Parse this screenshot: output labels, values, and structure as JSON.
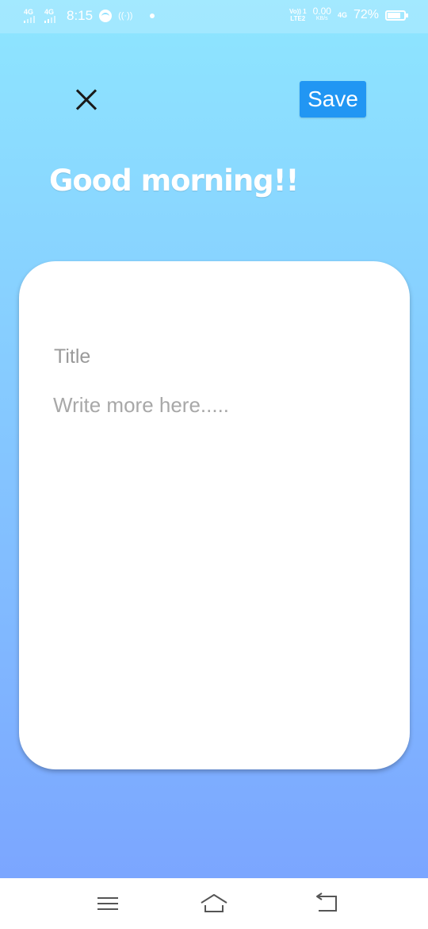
{
  "status_bar": {
    "net_left_1": "4G",
    "net_left_2": "4G",
    "time": "8:15",
    "volte_1": "Vo)) 1",
    "volte_2": "LTE2",
    "speed_value": "0.00",
    "speed_unit": "KB/s",
    "net_right": "4G",
    "battery_percent": "72%"
  },
  "header": {
    "save_label": "Save",
    "greeting": "Good morning!!"
  },
  "note": {
    "title_placeholder": "Title",
    "title_value": "",
    "body_placeholder": "Write more here.....",
    "body_value": ""
  },
  "colors": {
    "accent": "#2196f3",
    "gradient_top": "#8ee6ff",
    "gradient_bottom": "#7aa2ff",
    "card": "#ffffff"
  },
  "icons": {
    "close": "close-icon",
    "menu": "menu-icon",
    "home": "home-icon",
    "back": "back-icon",
    "battery": "battery-icon",
    "spotify": "spotify-icon",
    "hotspot": "hotspot-icon"
  }
}
